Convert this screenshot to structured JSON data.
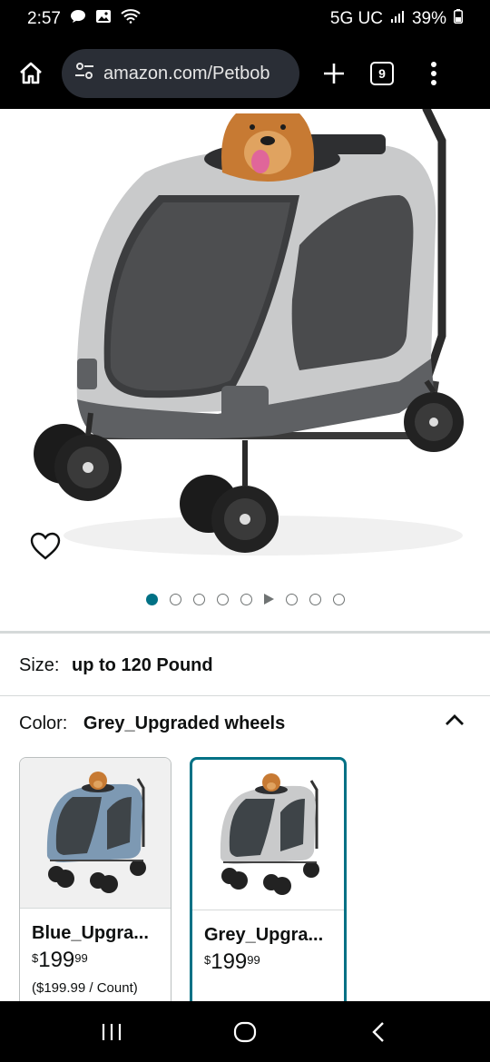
{
  "status": {
    "time": "2:57",
    "network": "5G UC",
    "battery": "39%"
  },
  "browser": {
    "url": "amazon.com/Petbob",
    "tab_count": "9"
  },
  "gallery": {
    "image_count": 9,
    "active_index": 0,
    "video_index": 5
  },
  "size": {
    "label": "Size:",
    "value": "up to 120 Pound"
  },
  "color": {
    "label": "Color:",
    "value": "Grey_Upgraded wheels"
  },
  "swatches": [
    {
      "name": "Blue_Upgra...",
      "price_symbol": "$",
      "price_whole": "199",
      "price_fraction": "99",
      "unit_price": "($199.99 / Count)",
      "body_color": "#7d99b3"
    },
    {
      "name": "Grey_Upgra...",
      "price_symbol": "$",
      "price_whole": "199",
      "price_fraction": "99",
      "unit_price": "",
      "body_color": "#c9cacb"
    }
  ],
  "colors": {
    "accent": "#007185",
    "stroller_grey": "#c9cacb",
    "stroller_dark": "#5e6063"
  }
}
